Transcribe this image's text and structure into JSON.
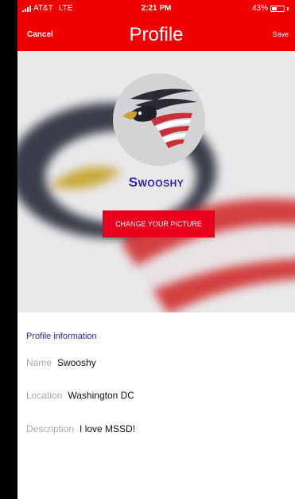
{
  "status_bar": {
    "carrier": "AT&T",
    "network": "LTE",
    "time": "2:21 PM",
    "battery": "43%",
    "battery_level": 0.43
  },
  "nav": {
    "cancel_label": "Cancel",
    "title": "Profile",
    "save_label": "Save"
  },
  "profile": {
    "username": "Swooshy",
    "change_picture_label": "CHANGE YOUR PICTURE"
  },
  "info": {
    "section_title": "Profile information",
    "fields": [
      {
        "label": "Name",
        "value": "Swooshy"
      },
      {
        "label": "Location",
        "value": "Washington DC"
      },
      {
        "label": "Description",
        "value": "I love MSSD!"
      }
    ]
  },
  "colors": {
    "brand_red": "#f00000",
    "accent_blue": "#2f1fb0"
  }
}
